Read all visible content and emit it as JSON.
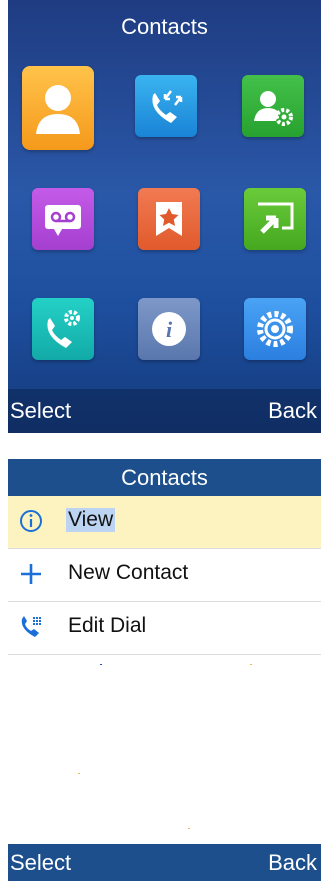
{
  "screen1": {
    "title": "Contacts",
    "softkeys": {
      "left": "Select",
      "right": "Back"
    },
    "icons": [
      "contacts-icon",
      "call-log-icon",
      "directory-settings-icon",
      "voicemail-icon",
      "favorites-icon",
      "call-forward-icon",
      "call-settings-icon",
      "info-icon",
      "settings-icon"
    ]
  },
  "screen2": {
    "title": "Contacts",
    "items": [
      {
        "label": "View",
        "icon": "info-circle-icon",
        "selected": true
      },
      {
        "label": "New Contact",
        "icon": "plus-icon",
        "selected": false
      },
      {
        "label": "Edit Dial",
        "icon": "phone-keypad-icon",
        "selected": false
      }
    ],
    "softkeys": {
      "left": "Select",
      "right": "Back"
    }
  },
  "colors": {
    "title_bar": "#1c4f8c",
    "selected_row": "#fdf3c0",
    "label_highlight": "#bcd4f2",
    "accent": "#1a6fd8"
  }
}
